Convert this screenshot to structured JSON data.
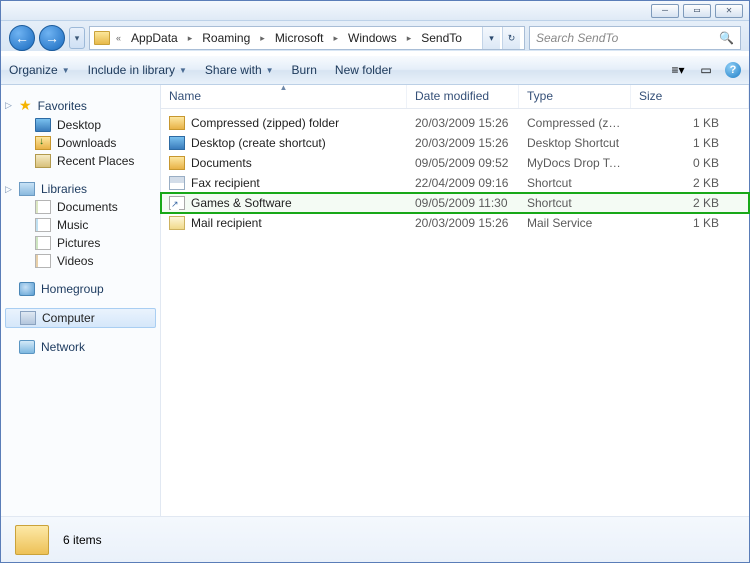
{
  "titlebar": {
    "min": "—",
    "max": "▭",
    "close": "✕"
  },
  "nav": {
    "back": "←",
    "fwd": "→",
    "hist": "▾"
  },
  "breadcrumbs": {
    "leading": "«",
    "items": [
      "AppData",
      "Roaming",
      "Microsoft",
      "Windows",
      "SendTo"
    ],
    "dd": "▾",
    "refresh": "↻"
  },
  "search": {
    "placeholder": "Search SendTo",
    "icon": "🔍"
  },
  "cmdbar": {
    "organize": "Organize",
    "include": "Include in library",
    "share": "Share with",
    "burn": "Burn",
    "newfolder": "New folder",
    "view_dd": "▾",
    "help": "?"
  },
  "navpane": {
    "favorites": "Favorites",
    "desktop": "Desktop",
    "downloads": "Downloads",
    "recent": "Recent Places",
    "libraries": "Libraries",
    "documents": "Documents",
    "music": "Music",
    "pictures": "Pictures",
    "videos": "Videos",
    "homegroup": "Homegroup",
    "computer": "Computer",
    "network": "Network"
  },
  "columns": {
    "name": "Name",
    "date": "Date modified",
    "type": "Type",
    "size": "Size"
  },
  "files": [
    {
      "name": "Compressed (zipped) folder",
      "date": "20/03/2009 15:26",
      "type": "Compressed (zippe...",
      "size": "1 KB",
      "icon": "zip",
      "hl": false
    },
    {
      "name": "Desktop (create shortcut)",
      "date": "20/03/2009 15:26",
      "type": "Desktop Shortcut",
      "size": "1 KB",
      "icon": "desk",
      "hl": false
    },
    {
      "name": "Documents",
      "date": "09/05/2009 09:52",
      "type": "MyDocs Drop Target",
      "size": "0 KB",
      "icon": "docs",
      "hl": false
    },
    {
      "name": "Fax recipient",
      "date": "22/04/2009 09:16",
      "type": "Shortcut",
      "size": "2 KB",
      "icon": "fax",
      "hl": false
    },
    {
      "name": "Games & Software",
      "date": "09/05/2009 11:30",
      "type": "Shortcut",
      "size": "2 KB",
      "icon": "sc",
      "hl": true
    },
    {
      "name": "Mail recipient",
      "date": "20/03/2009 15:26",
      "type": "Mail Service",
      "size": "1 KB",
      "icon": "mail",
      "hl": false
    }
  ],
  "status": {
    "count": "6 items"
  }
}
